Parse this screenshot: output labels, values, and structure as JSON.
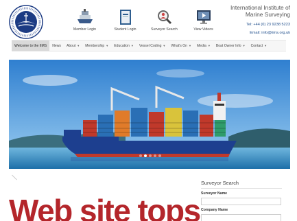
{
  "logo": {
    "alt_text": "International Institute of Marine Surveying"
  },
  "quick_links": [
    {
      "label": "Member Login",
      "icon": "ship-icon"
    },
    {
      "label": "Student Login",
      "icon": "book-icon"
    },
    {
      "label": "Surveyor Search",
      "icon": "magnifier-person-icon"
    },
    {
      "label": "View Videos",
      "icon": "monitor-play-icon"
    }
  ],
  "contact": {
    "org_line1": "International Institute of",
    "org_line2": "Marine Surveying",
    "tel": "Tel: +44 (0) 23 9238 5223",
    "email": "Email: info@iims.org.uk"
  },
  "nav": [
    {
      "label": "Welcome to the IIMS",
      "dropdown": false,
      "active": true
    },
    {
      "label": "News",
      "dropdown": false
    },
    {
      "label": "About",
      "dropdown": true
    },
    {
      "label": "Membership",
      "dropdown": true
    },
    {
      "label": "Education",
      "dropdown": true
    },
    {
      "label": "Vessel Coding",
      "dropdown": true
    },
    {
      "label": "What's On",
      "dropdown": true
    },
    {
      "label": "Media",
      "dropdown": true
    },
    {
      "label": "Boat Owner Info",
      "dropdown": true
    },
    {
      "label": "Contact",
      "dropdown": true
    }
  ],
  "hero": {
    "slides": 5,
    "active_slide": 1
  },
  "headline": "Web site tops",
  "surveyor_search": {
    "title": "Surveyor Search",
    "surveyor_name_label": "Surveyor Name",
    "company_name_label": "Company Name"
  },
  "colors": {
    "headline": "#b4262b",
    "link_blue": "#1f4e8c",
    "hull_blue": "#1d3f8f"
  }
}
